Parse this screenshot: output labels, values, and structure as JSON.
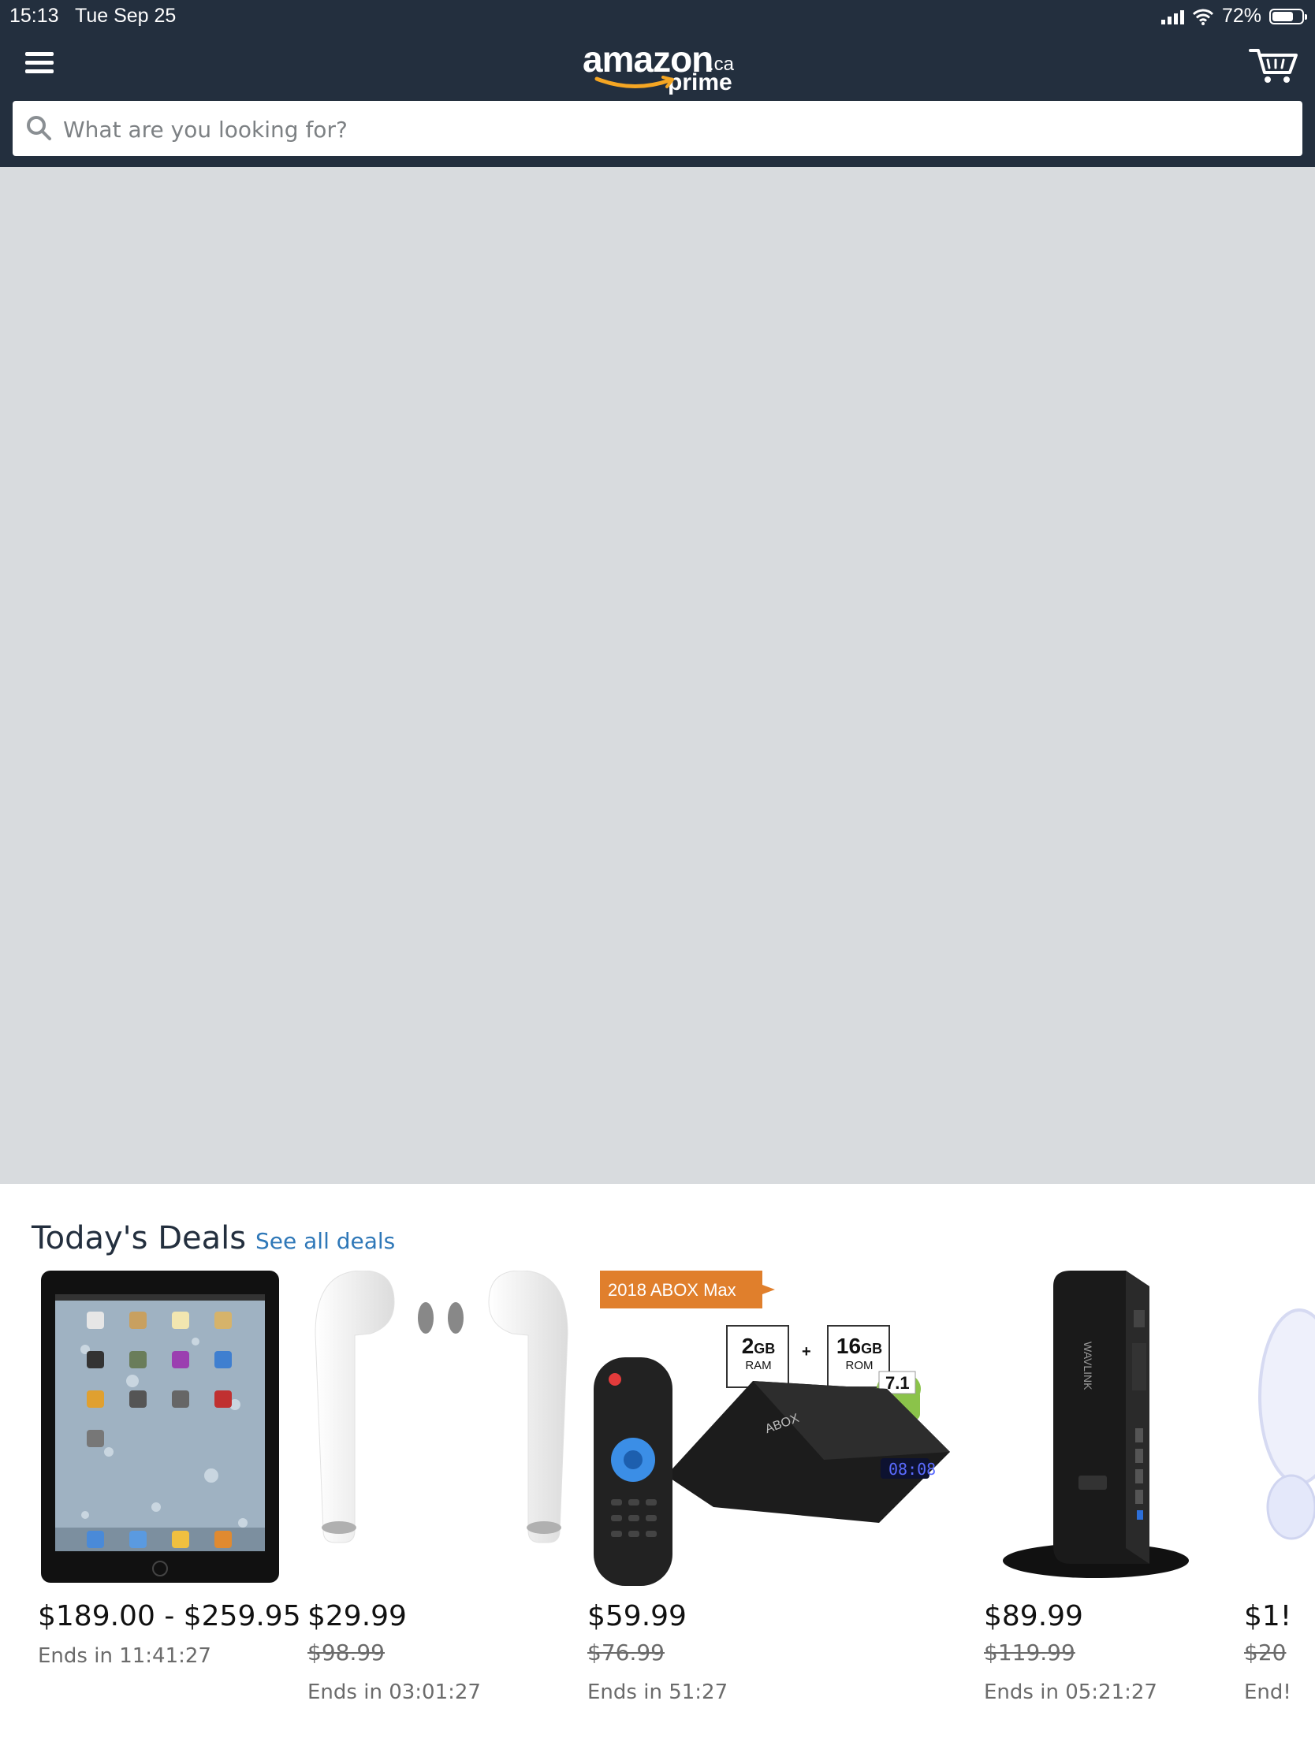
{
  "status_bar": {
    "time": "15:13",
    "date": "Tue Sep 25",
    "battery": "72%",
    "battery_level": 0.72
  },
  "header": {
    "logo_word": "amazon",
    "logo_tld": ".ca",
    "logo_sub": "prime",
    "search_placeholder": "What are you looking for?",
    "icons": [
      "menu-icon",
      "cart-icon",
      "search-icon"
    ]
  },
  "deals": {
    "title": "Today's Deals",
    "see_all": "See all deals",
    "items": [
      {
        "price": "$189.00 - $259.95",
        "was": "",
        "ends": "Ends in 11:41:27"
      },
      {
        "price": "$29.99",
        "was": "$98.99",
        "ends": "Ends in 03:01:27"
      },
      {
        "price": "$59.99",
        "was": "$76.99",
        "ends": "Ends in 51:27",
        "banner": "2018 ABOX Max",
        "spec1_big": "2",
        "spec1_unit": "GB",
        "spec1_label": "RAM",
        "spec2_big": "16",
        "spec2_unit": "GB",
        "spec2_label": "ROM",
        "plus": "+",
        "version": "7.1",
        "display": "08:08",
        "brand": "ABOX"
      },
      {
        "price": "$89.99",
        "was": "$119.99",
        "ends": "Ends in 05:21:27",
        "brand": "WAVLINK"
      },
      {
        "price": "$1!",
        "was": "$20",
        "ends": "End!"
      }
    ]
  },
  "colors": {
    "header_bg": "#232f3e",
    "hero_bg": "#d8dbde",
    "link": "#2f78b8",
    "logo_arrow": "#f5a623"
  }
}
